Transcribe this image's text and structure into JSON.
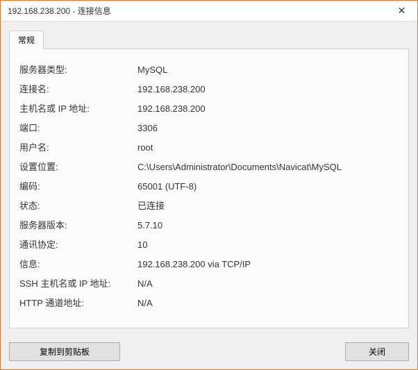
{
  "window": {
    "title": "192.168.238.200 - 连接信息"
  },
  "tabs": {
    "general": "常规"
  },
  "info": {
    "server_type": {
      "label": "服务器类型:",
      "value": "MySQL"
    },
    "connection_name": {
      "label": "连接名:",
      "value": "192.168.238.200"
    },
    "host": {
      "label": "主机名或 IP 地址:",
      "value": "192.168.238.200"
    },
    "port": {
      "label": "端口:",
      "value": "3306"
    },
    "username": {
      "label": "用户名:",
      "value": "root"
    },
    "settings_location": {
      "label": "设置位置:",
      "value": "C:\\Users\\Administrator\\Documents\\Navicat\\MySQL"
    },
    "encoding": {
      "label": "编码:",
      "value": "65001 (UTF-8)"
    },
    "status": {
      "label": "状态:",
      "value": "已连接"
    },
    "server_version": {
      "label": "服务器版本:",
      "value": "5.7.10"
    },
    "protocol": {
      "label": "通讯协定:",
      "value": "10"
    },
    "information": {
      "label": "信息:",
      "value": "192.168.238.200 via TCP/IP"
    },
    "ssh_host": {
      "label": "SSH 主机名或 IP 地址:",
      "value": "N/A"
    },
    "http_tunnel": {
      "label": "HTTP 通道地址:",
      "value": "N/A"
    }
  },
  "buttons": {
    "copy": "复制到剪贴板",
    "close": "关闭"
  }
}
